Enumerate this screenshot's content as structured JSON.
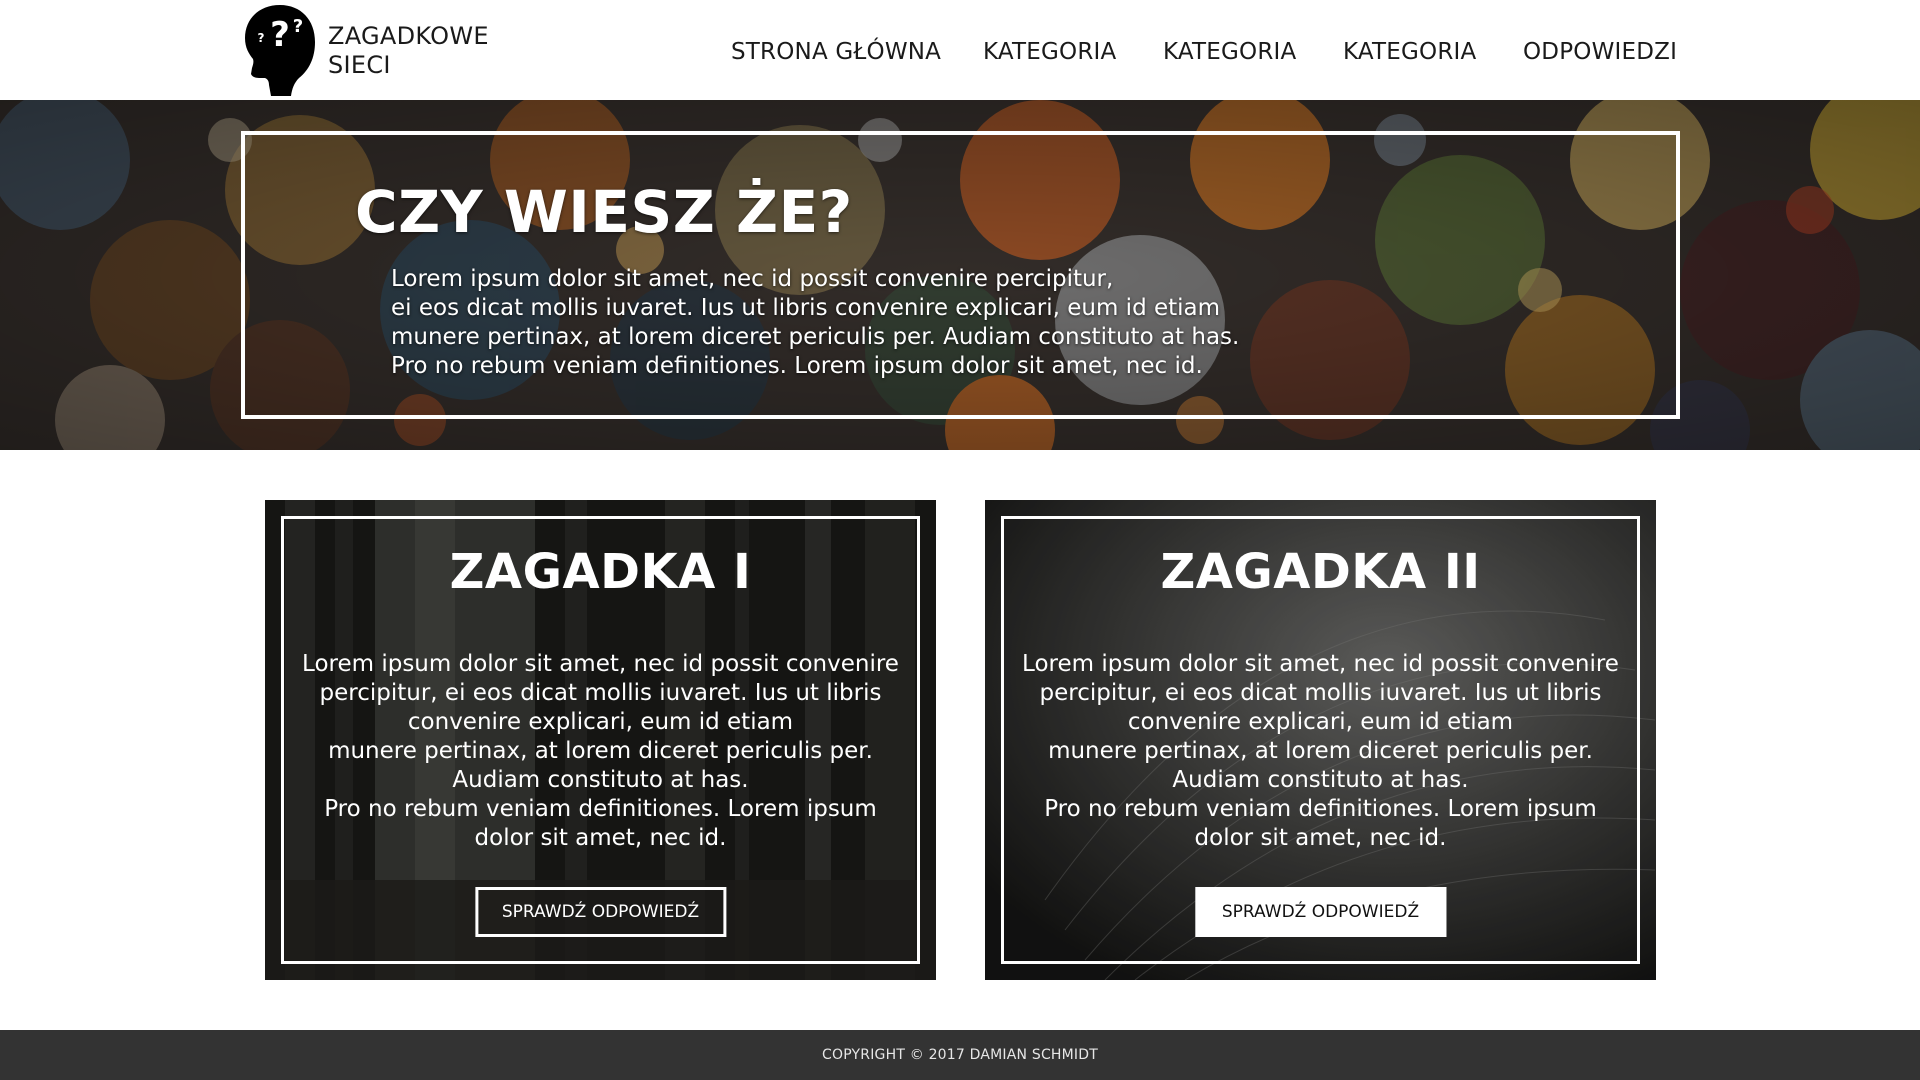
{
  "header": {
    "logo_icon": "head-question-icon",
    "logo_glyph": "?",
    "site_name_line1": "ZAGADKOWE",
    "site_name_line2": "SIECI",
    "menu": [
      {
        "label": "STRONA GŁÓWNA"
      },
      {
        "label": "KATEGORIA"
      },
      {
        "label": "KATEGORIA"
      },
      {
        "label": "KATEGORIA"
      },
      {
        "label": "ODPOWIEDZI"
      }
    ]
  },
  "hero": {
    "title": "CZY WIESZ ŻE?",
    "lines": [
      "Lorem ipsum dolor sit amet, nec id possit convenire percipitur,",
      "ei eos dicat mollis iuvaret. Ius ut libris convenire explicari, eum id etiam",
      "munere pertinax, at lorem diceret periculis per. Audiam constituto at has.",
      "Pro no rebum veniam definitiones. Lorem ipsum dolor sit amet, nec id."
    ]
  },
  "cards": [
    {
      "title": "ZAGADKA I",
      "lines": [
        "Lorem ipsum dolor sit amet, nec id possit convenire",
        "percipitur, ei eos dicat mollis iuvaret. Ius ut libris",
        "convenire explicari, eum id etiam",
        "munere pertinax, at lorem diceret periculis per.",
        "Audiam constituto at has.",
        "Pro no rebum veniam definitiones. Lorem ipsum",
        "dolor sit amet, nec id."
      ],
      "button": "SPRAWDŹ ODPOWIEDŹ"
    },
    {
      "title": "ZAGADKA II",
      "lines": [
        "Lorem ipsum dolor sit amet, nec id possit convenire",
        "percipitur, ei eos dicat mollis iuvaret. Ius ut libris",
        "convenire explicari, eum id etiam",
        "munere pertinax, at lorem diceret periculis per.",
        "Audiam constituto at has.",
        "Pro no rebum veniam definitiones. Lorem ipsum",
        "dolor sit amet, nec id."
      ],
      "button": "SPRAWDŹ ODPOWIEDŹ"
    }
  ],
  "footer": {
    "copyright": "COPYRIGHT © 2017 DAMIAN SCHMIDT"
  },
  "colors": {
    "nav_bg": "#ffffff",
    "footer_bg": "#333333",
    "text_light": "#ffffff",
    "text_dark": "#1a1a1a"
  }
}
